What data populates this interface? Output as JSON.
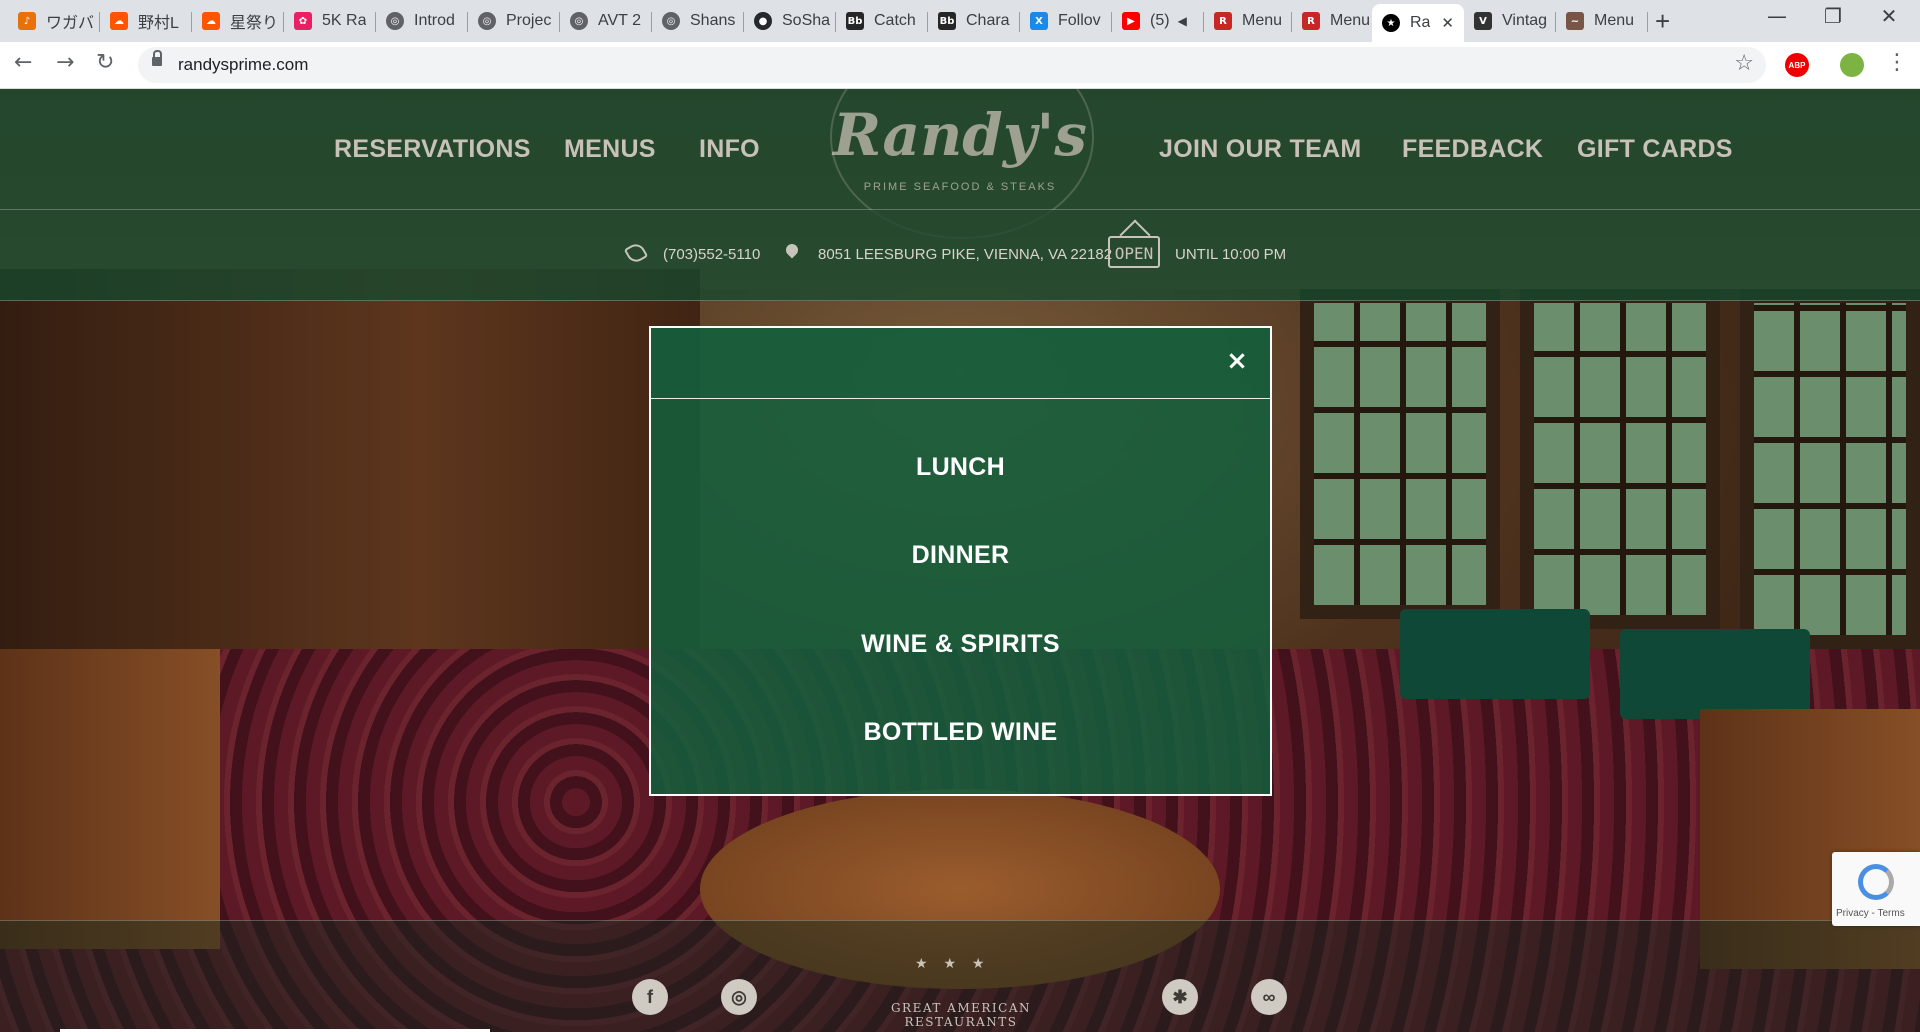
{
  "browser": {
    "tabs": [
      {
        "label": "ワガバ",
        "icon": "headphones-icon",
        "color": "#e8710a"
      },
      {
        "label": "野村L",
        "icon": "soundcloud-icon",
        "color": "#ff5500"
      },
      {
        "label": "星祭り",
        "icon": "soundcloud-icon",
        "color": "#ff5500"
      },
      {
        "label": "5K Ra",
        "icon": "anime-icon",
        "color": "#e91e63"
      },
      {
        "label": "Introd",
        "icon": "globe-icon",
        "color": "#5f6368"
      },
      {
        "label": "Projec",
        "icon": "globe-icon",
        "color": "#5f6368"
      },
      {
        "label": "AVT 2",
        "icon": "globe-icon",
        "color": "#5f6368"
      },
      {
        "label": "Shans",
        "icon": "globe-icon",
        "color": "#5f6368"
      },
      {
        "label": "SoSha",
        "icon": "github-icon",
        "color": "#24292e"
      },
      {
        "label": "Catch",
        "icon": "blackboard-icon",
        "color": "#262626"
      },
      {
        "label": "Chara",
        "icon": "blackboard-icon",
        "color": "#262626"
      },
      {
        "label": "Follov",
        "icon": "x-logo-icon",
        "color": "#1e88e5"
      },
      {
        "label": "(5)",
        "icon": "youtube-icon",
        "color": "#ff0000"
      },
      {
        "label": "Menu",
        "icon": "restaurant-icon",
        "color": "#c62828"
      },
      {
        "label": "Menu",
        "icon": "restaurant-icon",
        "color": "#c62828"
      },
      {
        "label": "Ra",
        "icon": "star-circle-icon",
        "color": "#000000",
        "active": true
      },
      {
        "label": "Vintag",
        "icon": "vintage-icon",
        "color": "#333333"
      },
      {
        "label": "Menu",
        "icon": "lobster-icon",
        "color": "#795548"
      }
    ],
    "url": "randysprime.com"
  },
  "site": {
    "nav_left": [
      "RESERVATIONS",
      "MENUS",
      "INFO"
    ],
    "nav_right": [
      "JOIN OUR TEAM",
      "FEEDBACK",
      "GIFT CARDS"
    ],
    "logo_script": "Randy's",
    "logo_sub": "PRIME SEAFOOD & STEAKS",
    "phone": "(703)552-5110",
    "address": "8051 LEESBURG PIKE, VIENNA, VA 22182",
    "open_sign": "OPEN",
    "hours": "UNTIL 10:00 PM"
  },
  "modal": {
    "close_symbol": "×",
    "items": [
      "LUNCH",
      "DINNER",
      "WINE & SPIRITS",
      "BOTTLED WINE"
    ]
  },
  "footer": {
    "stars": "★ ★ ★",
    "brand": "GREAT AMERICAN RESTAURANTS",
    "social_icons": [
      "facebook-icon",
      "instagram-icon",
      "yelp-icon",
      "tripadvisor-icon"
    ],
    "recaptcha_text": "Privacy - Terms"
  },
  "colors": {
    "header_green": "#14462d",
    "modal_green": "#145f3c",
    "nav_text": "#c7c1b7"
  }
}
